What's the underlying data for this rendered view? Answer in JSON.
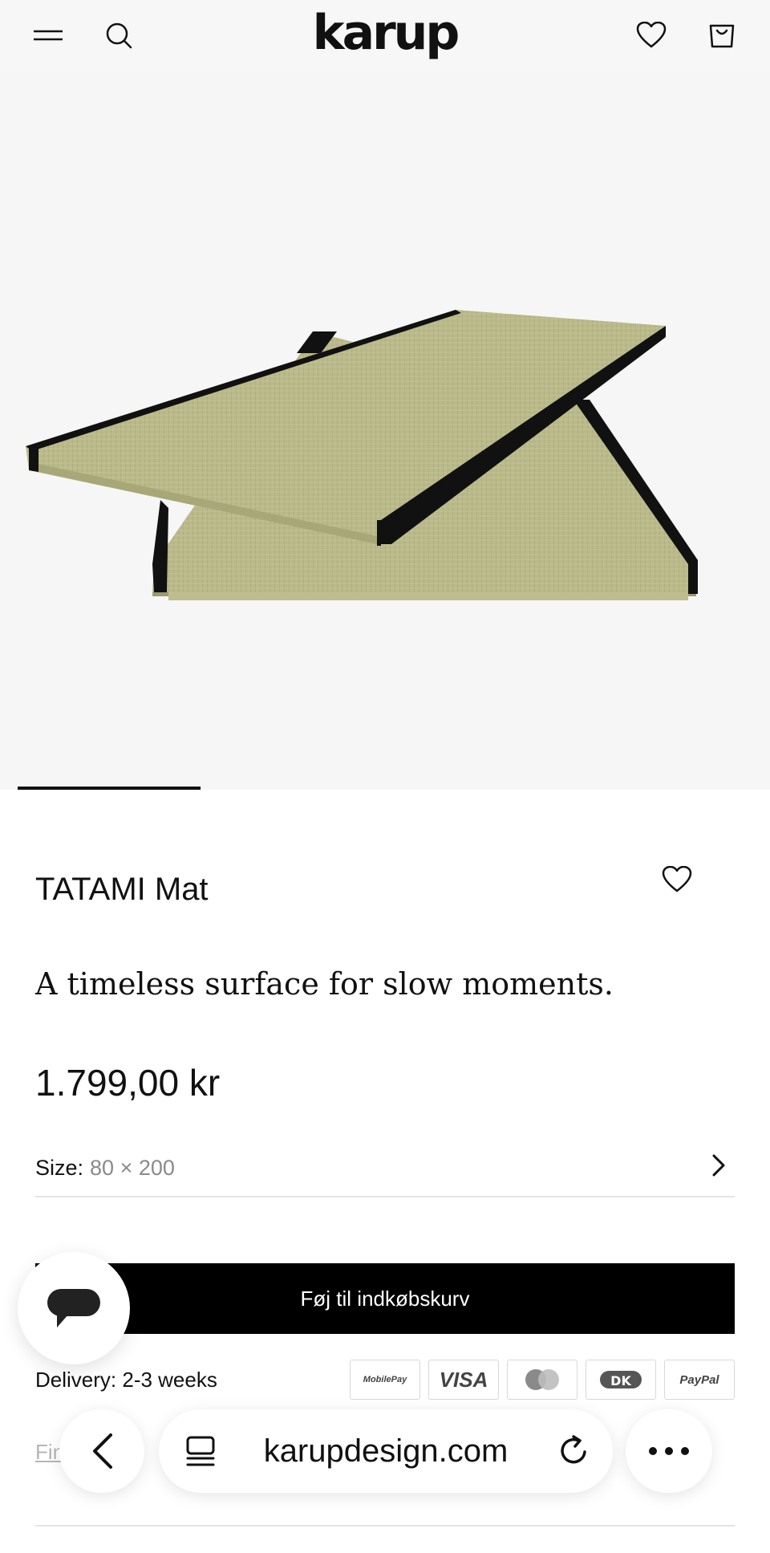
{
  "header": {
    "logo": "karup",
    "menu_icon": "menu-icon",
    "search_icon": "search-icon",
    "wishlist_icon": "heart-icon",
    "cart_icon": "shopping-bag-icon"
  },
  "gallery": {
    "image_alt": "TATAMI Mat",
    "progress": 0.24
  },
  "product": {
    "title": "TATAMI Mat",
    "tagline": "A timeless surface for slow moments.",
    "price": "1.799,00 kr",
    "favorite_icon": "heart-icon"
  },
  "size": {
    "label": "Size:",
    "value": "80 × 200"
  },
  "cart": {
    "button_label": "Føj til indkøbskurv"
  },
  "delivery": {
    "text": "Delivery: 2-3 weeks"
  },
  "payment_methods": [
    "MobilePay",
    "VISA",
    "Mastercard",
    "Dankort",
    "PayPal"
  ],
  "find_link": {
    "text": "Fin        s"
  },
  "browser": {
    "url": "karupdesign.com",
    "back_icon": "chevron-left-icon",
    "tabs_icon": "tabs-icon",
    "reload_icon": "reload-icon",
    "more_icon": "more-icon"
  },
  "colors": {
    "accent": "#000000",
    "background": "#f6f6f7",
    "muted_text": "#8a8a8a",
    "tatami_green": "#b9b98a"
  }
}
